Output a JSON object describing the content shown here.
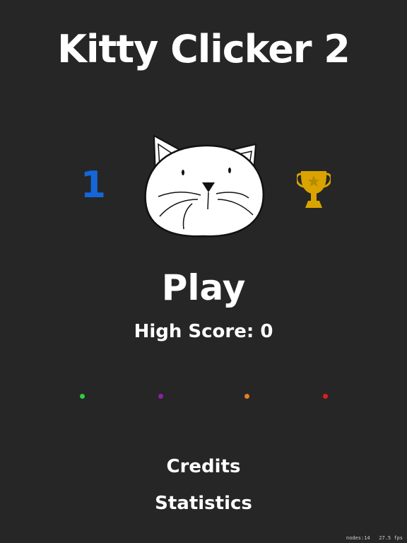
{
  "game": {
    "title": "Kitty Clicker 2",
    "level": "1",
    "play_label": "Play",
    "high_score_label": "High Score: 0",
    "credits_label": "Credits",
    "statistics_label": "Statistics"
  },
  "indicators": [
    {
      "color": "#2ecc40"
    },
    {
      "color": "#8e1fa6"
    },
    {
      "color": "#e67e22"
    },
    {
      "color": "#e01e1e"
    }
  ],
  "debug": {
    "nodes": "nodes:14",
    "fps": "27.5 fps"
  },
  "colors": {
    "background": "#262626",
    "level": "#1566d8",
    "trophy": "#d9a400"
  },
  "icons": {
    "cat": "cat-face-icon",
    "trophy": "trophy-icon"
  }
}
